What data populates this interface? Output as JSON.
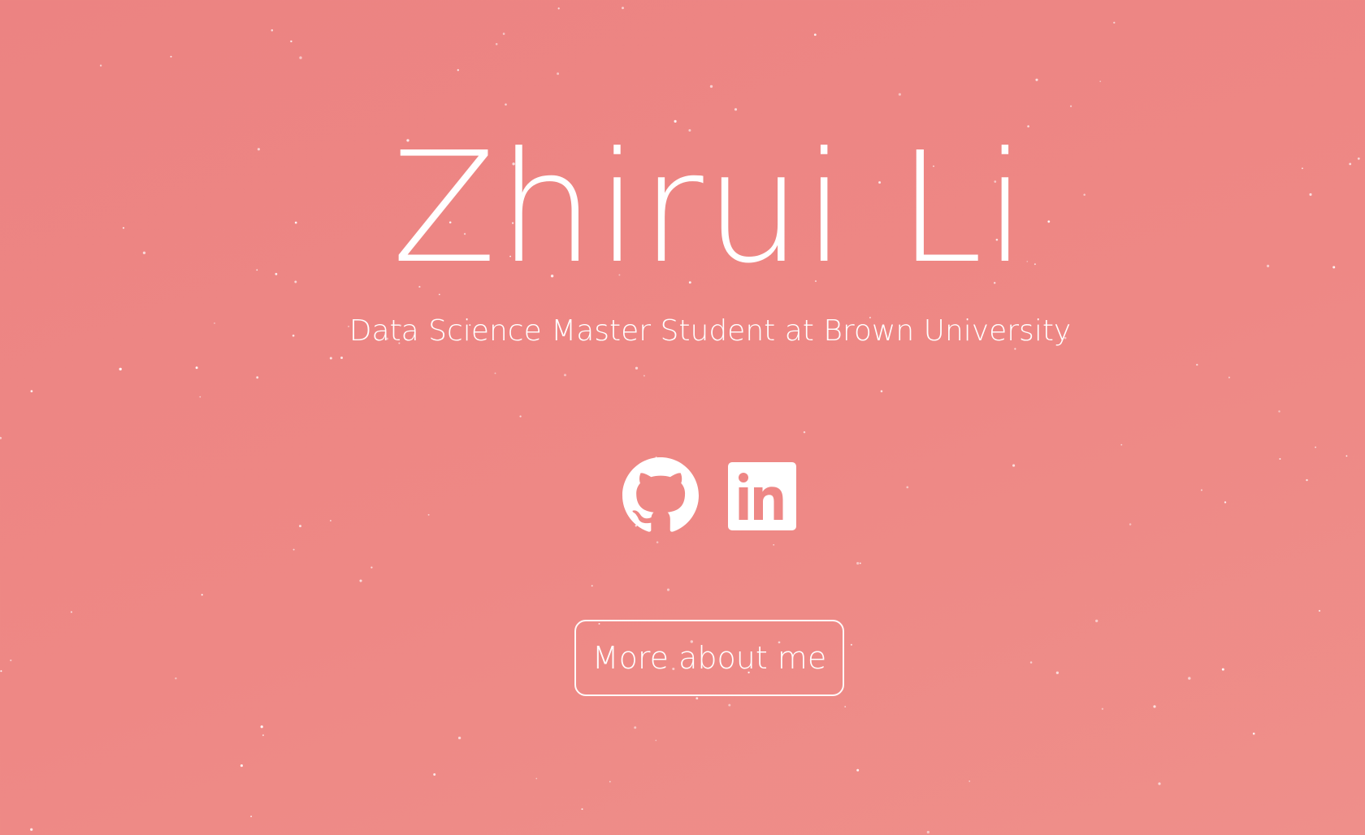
{
  "hero": {
    "name": "Zhirui Li",
    "tagline": "Data Science Master Student at Brown University",
    "more_button_label": "More about me"
  },
  "socials": [
    {
      "icon": "github-icon",
      "label": "GitHub"
    },
    {
      "icon": "linkedin-icon",
      "label": "LinkedIn"
    }
  ],
  "theme": {
    "background": "#ee8785",
    "foreground": "#ffffff"
  }
}
